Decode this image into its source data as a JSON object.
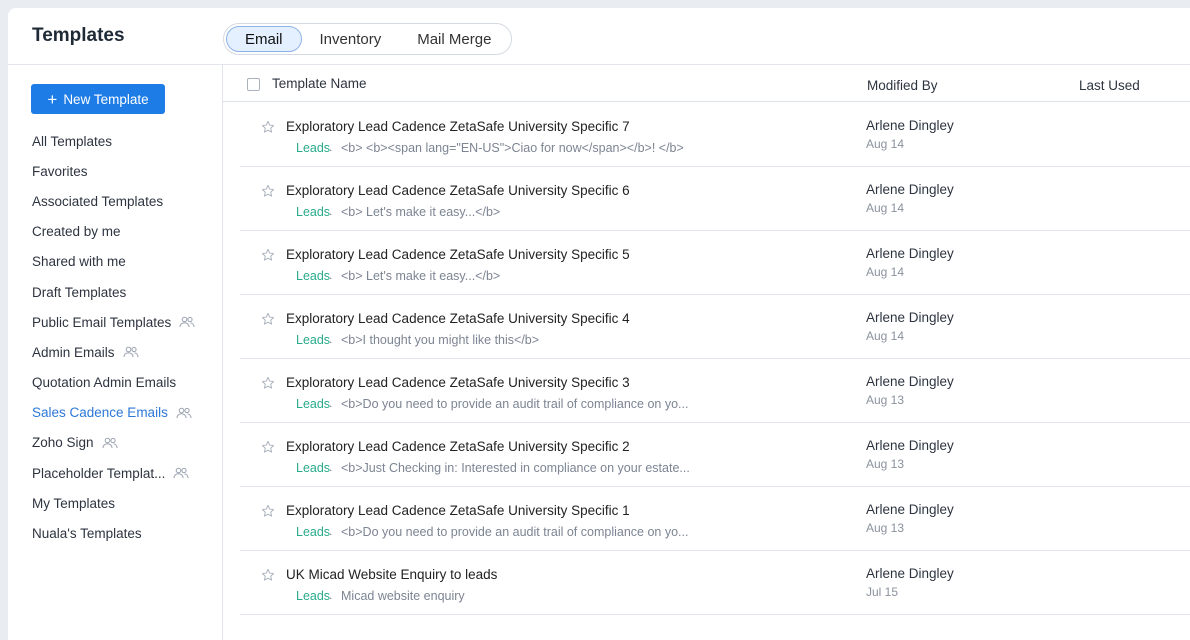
{
  "header": {
    "title": "Templates",
    "tabs": [
      {
        "label": "Email",
        "active": true
      },
      {
        "label": "Inventory",
        "active": false
      },
      {
        "label": "Mail Merge",
        "active": false
      }
    ]
  },
  "sidebar": {
    "new_button": "New Template",
    "items": [
      {
        "label": "All Templates",
        "shared": false,
        "active": false
      },
      {
        "label": "Favorites",
        "shared": false,
        "active": false
      },
      {
        "label": "Associated Templates",
        "shared": false,
        "active": false
      },
      {
        "label": "Created by me",
        "shared": false,
        "active": false
      },
      {
        "label": "Shared with me",
        "shared": false,
        "active": false
      },
      {
        "label": "Draft Templates",
        "shared": false,
        "active": false
      },
      {
        "label": "Public Email Templates",
        "shared": true,
        "active": false
      },
      {
        "label": "Admin Emails",
        "shared": true,
        "active": false
      },
      {
        "label": "Quotation Admin Emails",
        "shared": false,
        "active": false
      },
      {
        "label": "Sales Cadence Emails",
        "shared": true,
        "active": true
      },
      {
        "label": "Zoho Sign",
        "shared": true,
        "active": false
      },
      {
        "label": "Placeholder Templat...",
        "shared": true,
        "active": false
      },
      {
        "label": "My Templates",
        "shared": false,
        "active": false
      },
      {
        "label": "Nuala's Templates",
        "shared": false,
        "active": false
      }
    ]
  },
  "table": {
    "columns": {
      "name": "Template Name",
      "modified_by": "Modified By",
      "last_used": "Last Used"
    },
    "rows": [
      {
        "name": "Exploratory Lead Cadence ZetaSafe University Specific 7",
        "module": "Leads",
        "preview": "<b> <b><span lang=\"EN-US\">Ciao for now</span></b>! </b>",
        "modified_by": "Arlene Dingley",
        "date": "Aug 14"
      },
      {
        "name": "Exploratory Lead Cadence ZetaSafe University Specific 6",
        "module": "Leads",
        "preview": "<b> Let's make it easy...</b>",
        "modified_by": "Arlene Dingley",
        "date": "Aug 14"
      },
      {
        "name": "Exploratory Lead Cadence ZetaSafe University Specific 5",
        "module": "Leads",
        "preview": "<b> Let's make it easy...</b>",
        "modified_by": "Arlene Dingley",
        "date": "Aug 14"
      },
      {
        "name": "Exploratory Lead Cadence ZetaSafe University Specific 4",
        "module": "Leads",
        "preview": "<b>I thought you might like this</b>",
        "modified_by": "Arlene Dingley",
        "date": "Aug 14"
      },
      {
        "name": "Exploratory Lead Cadence ZetaSafe University Specific 3",
        "module": "Leads",
        "preview": "<b>Do you need to provide an audit trail of compliance on yo...",
        "modified_by": "Arlene Dingley",
        "date": "Aug 13"
      },
      {
        "name": "Exploratory Lead Cadence ZetaSafe University Specific 2",
        "module": "Leads",
        "preview": "<b>Just Checking in: Interested in compliance on your estate...",
        "modified_by": "Arlene Dingley",
        "date": "Aug 13"
      },
      {
        "name": "Exploratory Lead Cadence ZetaSafe University Specific 1",
        "module": "Leads",
        "preview": "<b>Do you need to provide an audit trail of compliance on yo...",
        "modified_by": "Arlene Dingley",
        "date": "Aug 13"
      },
      {
        "name": "UK Micad Website Enquiry to leads",
        "module": "Leads",
        "preview": "Micad website enquiry",
        "modified_by": "Arlene Dingley",
        "date": "Jul 15"
      }
    ]
  },
  "icons": {
    "star": "star-icon",
    "group": "group-icon",
    "plus": "plus-icon"
  },
  "colors": {
    "accent": "#1e7ce6",
    "active_nav": "#2d78d6",
    "module": "#2bab8c"
  }
}
